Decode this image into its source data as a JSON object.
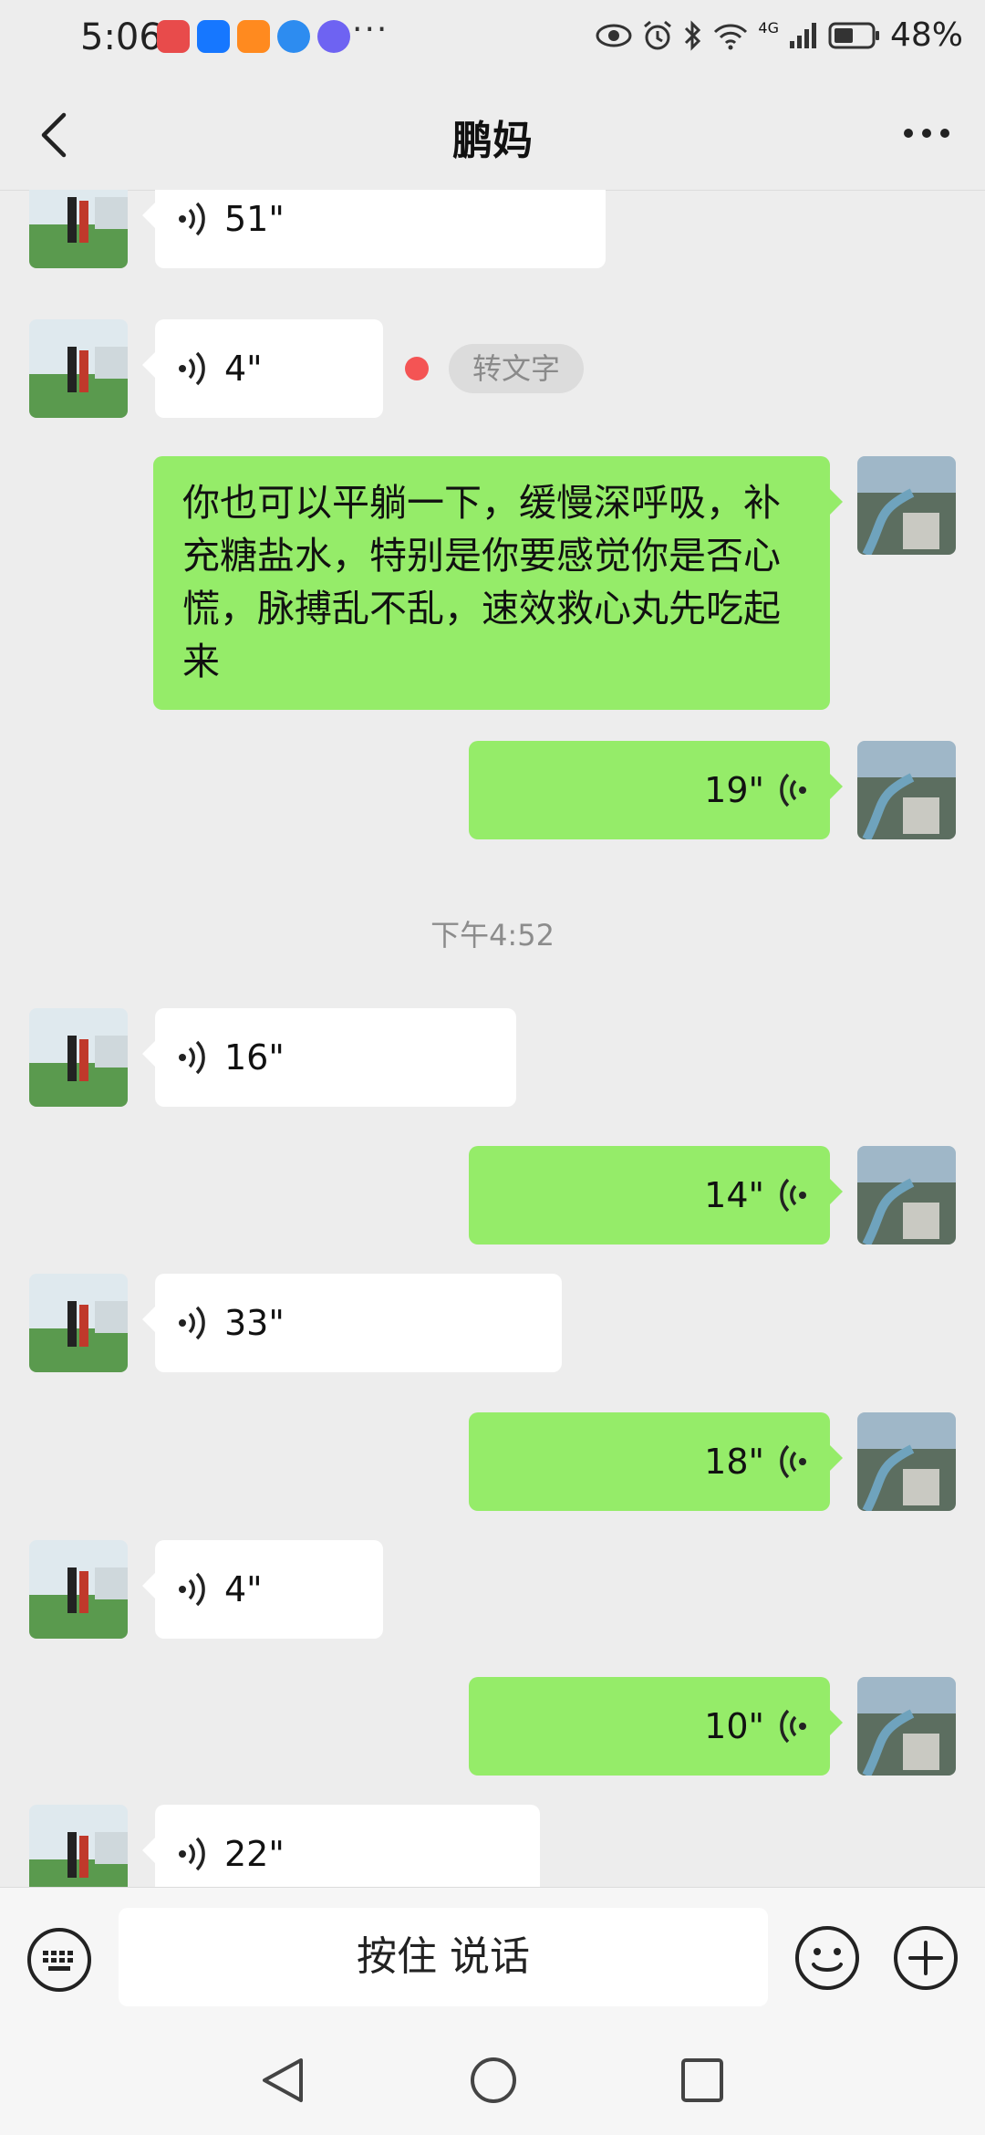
{
  "status_bar": {
    "time": "5:06",
    "overflow_dots": "···",
    "battery_percent": "48%",
    "network": "4G"
  },
  "header": {
    "title": "鹏妈"
  },
  "chat": {
    "transcribe_label": "转文字",
    "timestamp": "下午4:52",
    "messages": [
      {
        "side": "in",
        "type": "voice",
        "duration": "51\""
      },
      {
        "side": "in",
        "type": "voice",
        "duration": "4\"",
        "unread": true
      },
      {
        "side": "out",
        "type": "text",
        "text": "你也可以平躺一下，缓慢深呼吸，补充糖盐水，特别是你要感觉你是否心慌，脉搏乱不乱，速效救心丸先吃起来"
      },
      {
        "side": "out",
        "type": "voice",
        "duration": "19\""
      },
      {
        "side": "in",
        "type": "voice",
        "duration": "16\""
      },
      {
        "side": "out",
        "type": "voice",
        "duration": "14\""
      },
      {
        "side": "in",
        "type": "voice",
        "duration": "33\""
      },
      {
        "side": "out",
        "type": "voice",
        "duration": "18\""
      },
      {
        "side": "in",
        "type": "voice",
        "duration": "4\""
      },
      {
        "side": "out",
        "type": "voice",
        "duration": "10\""
      },
      {
        "side": "in",
        "type": "voice",
        "duration": "22\""
      }
    ]
  },
  "input_bar": {
    "hold_to_talk": "按住 说话"
  },
  "colors": {
    "sent_bubble": "#95ec69",
    "received_bubble": "#ffffff",
    "background": "#ededed",
    "unread_dot": "#f45454"
  },
  "icons": {
    "back": "chevron-left-icon",
    "more": "more-icon",
    "keyboard": "keyboard-icon",
    "emoji": "emoji-icon",
    "plus": "plus-circle-icon"
  }
}
